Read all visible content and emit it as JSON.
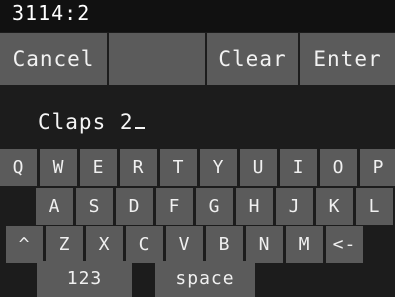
{
  "status_bar": {
    "text": "3114:2"
  },
  "toolbar": {
    "cancel_label": "Cancel",
    "blank_label": "",
    "clear_label": "Clear",
    "enter_label": "Enter"
  },
  "text_field": {
    "value": "Claps 2"
  },
  "keyboard": {
    "row1": [
      "Q",
      "W",
      "E",
      "R",
      "T",
      "Y",
      "U",
      "I",
      "O",
      "P"
    ],
    "row2": [
      "A",
      "S",
      "D",
      "F",
      "G",
      "H",
      "J",
      "K",
      "L"
    ],
    "row3": [
      "^",
      "Z",
      "X",
      "C",
      "V",
      "B",
      "N",
      "M",
      "<-"
    ],
    "numbers_label": "123",
    "space_label": "space"
  },
  "colors": {
    "background": "#1c1c1c",
    "key": "#5b5b5b",
    "text": "#f0f0f0"
  }
}
